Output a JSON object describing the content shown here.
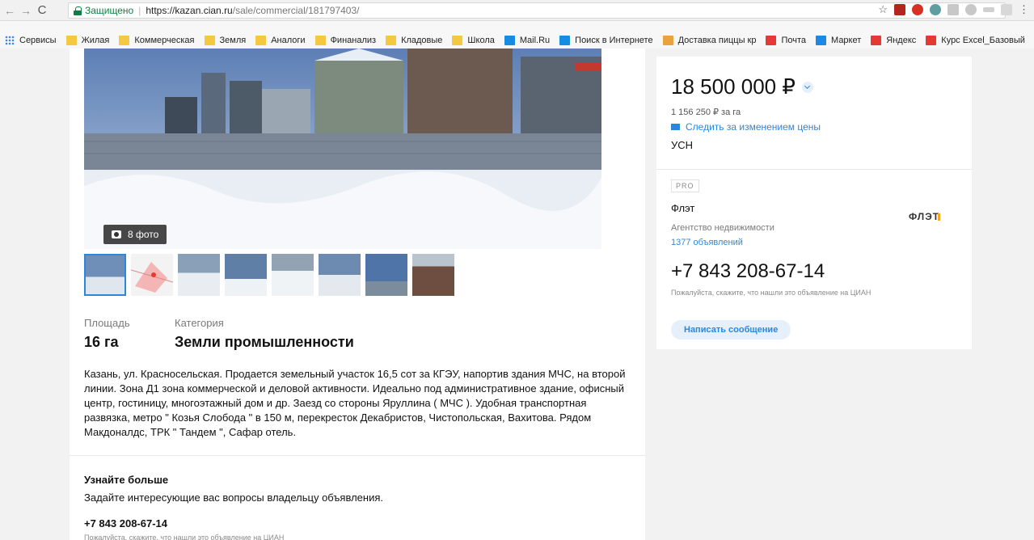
{
  "browser": {
    "secure_label": "Защищено",
    "url_host": "https://kazan.cian.ru",
    "url_path": "/sale/commercial/181797403/"
  },
  "bookmarks": [
    {
      "label": "Сервисы",
      "icon": "apps-icon"
    },
    {
      "label": "Жилая",
      "icon": "folder-icon"
    },
    {
      "label": "Коммерческая",
      "icon": "folder-icon"
    },
    {
      "label": "Земля",
      "icon": "folder-icon"
    },
    {
      "label": "Аналоги",
      "icon": "folder-icon"
    },
    {
      "label": "Финанализ",
      "icon": "folder-icon"
    },
    {
      "label": "Кладовые",
      "icon": "folder-icon"
    },
    {
      "label": "Школа",
      "icon": "folder-icon"
    },
    {
      "label": "Mail.Ru",
      "icon": "mailru-icon"
    },
    {
      "label": "Поиск в Интернете",
      "icon": "search-icon"
    },
    {
      "label": "Доставка пиццы кр",
      "icon": "pizza-icon"
    },
    {
      "label": "Почта",
      "icon": "mail-icon"
    },
    {
      "label": "Маркет",
      "icon": "cart-icon"
    },
    {
      "label": "Яндекс",
      "icon": "yandex-icon"
    },
    {
      "label": "Курс Excel_Базовый",
      "icon": "youtube-icon"
    }
  ],
  "gallery": {
    "photo_count": "8 фото"
  },
  "features": {
    "area_label": "Площадь",
    "area_value": "16 га",
    "category_label": "Категория",
    "category_value": "Земли промышленности"
  },
  "description": "Казань, ул. Красносельская. Продается земельный участок 16,5 сот за КГЭУ, напортив здания МЧС, на второй линии. Зона Д1 зона коммерческой и деловой активности. Идеально под административное здание, офисный центр, гостиницу, многоэтажный дом и др. Заезд со стороны Яруллина ( МЧС ). Удобная транспортная развязка, метро \" Козья Слобода \" в 150 м, перекресток Декабристов, Чистопольская, Вахитова. Рядом Макдоналдс, ТРК \" Тандем \", Сафар отель.",
  "learn_more": {
    "title": "Узнайте больше",
    "subtitle": "Задайте интересующие вас вопросы владельцу объявления.",
    "phone": "+7 843 208-67-14",
    "note": "Пожалуйста, скажите, что нашли это объявление на ЦИАН"
  },
  "price": {
    "value": "18 500 000 ₽",
    "per_unit": "1 156 250 ₽ за га",
    "track_label": "Следить за изменением цены",
    "tax": "УСН"
  },
  "agent": {
    "badge": "PRO",
    "name": "Флэт",
    "type": "Агентство недвижимости",
    "listings": "1377 объявлений",
    "logo_text": "ФЛЭТ",
    "phone": "+7 843 208-67-14",
    "note": "Пожалуйста, скажите, что нашли это объявление на ЦИАН",
    "message_button": "Написать сообщение"
  },
  "colors": {
    "accent": "#2b87db",
    "secure": "#0b8043"
  }
}
